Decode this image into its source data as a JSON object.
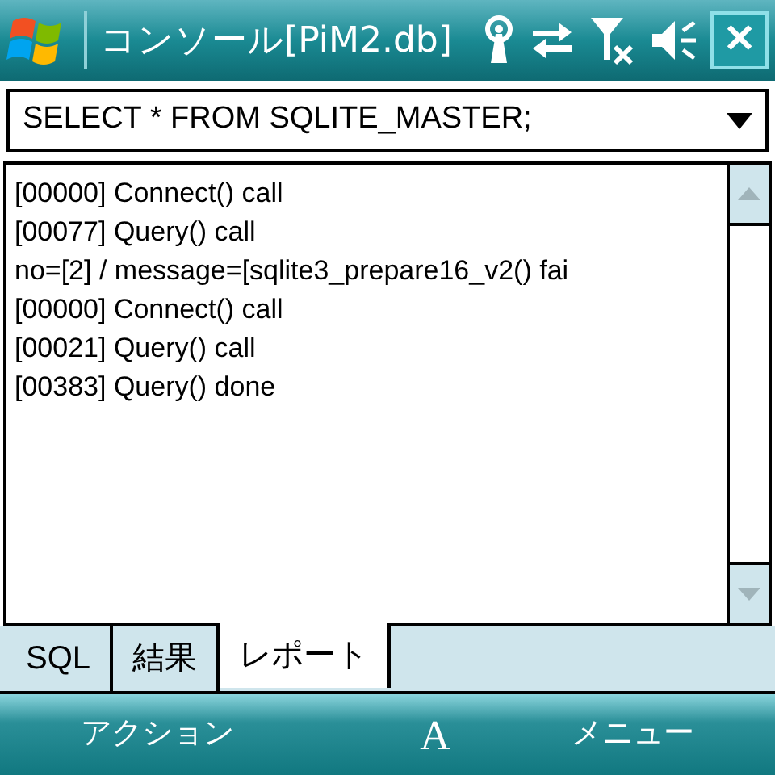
{
  "title_bar": {
    "title": "コンソール[PiM2.db]",
    "close": "✕"
  },
  "sql_combo": {
    "value": "SELECT * FROM SQLITE_MASTER;"
  },
  "log_lines": [
    "[00000] Connect() call",
    "[00077] Query() call",
    "no=[2] / message=[sqlite3_prepare16_v2() fai",
    "[00000] Connect() call",
    "[00021] Query() call",
    "[00383] Query() done"
  ],
  "tabs": [
    {
      "label": "SQL",
      "selected": false
    },
    {
      "label": "結果",
      "selected": false
    },
    {
      "label": "レポート",
      "selected": true
    }
  ],
  "softkeys": {
    "left": "アクション",
    "center": "A",
    "right": "メニュー"
  }
}
